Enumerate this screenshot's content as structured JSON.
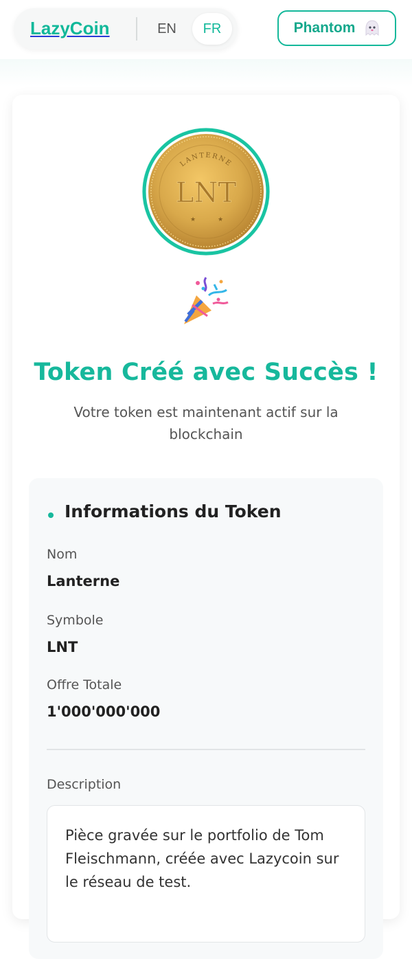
{
  "header": {
    "logo": "LazyCoin",
    "languages": [
      {
        "code": "EN",
        "active": false
      },
      {
        "code": "FR",
        "active": true
      }
    ],
    "wallet_button": "Phantom",
    "wallet_icon": "phantom-ghost-icon"
  },
  "coin": {
    "name_arc": "LANTERNE",
    "symbol": "LNT",
    "colors": {
      "ring": "#19c4a2",
      "gold": "#d9a94b"
    }
  },
  "success": {
    "icon": "party-popper-icon",
    "title": "Token Créé avec Succès !",
    "subtitle": "Votre token est maintenant actif sur la blockchain"
  },
  "token_info": {
    "section_title": "Informations du Token",
    "fields": [
      {
        "label": "Nom",
        "value": "Lanterne"
      },
      {
        "label": "Symbole",
        "value": "LNT"
      },
      {
        "label": "Offre Totale",
        "value": "1'000'000'000"
      }
    ],
    "description_label": "Description",
    "description": "Pièce gravée sur le portfolio de Tom Fleischmann, créée avec Lazycoin sur le réseau de test."
  },
  "colors": {
    "accent": "#17b89c",
    "text": "#222222",
    "muted": "#555555"
  }
}
